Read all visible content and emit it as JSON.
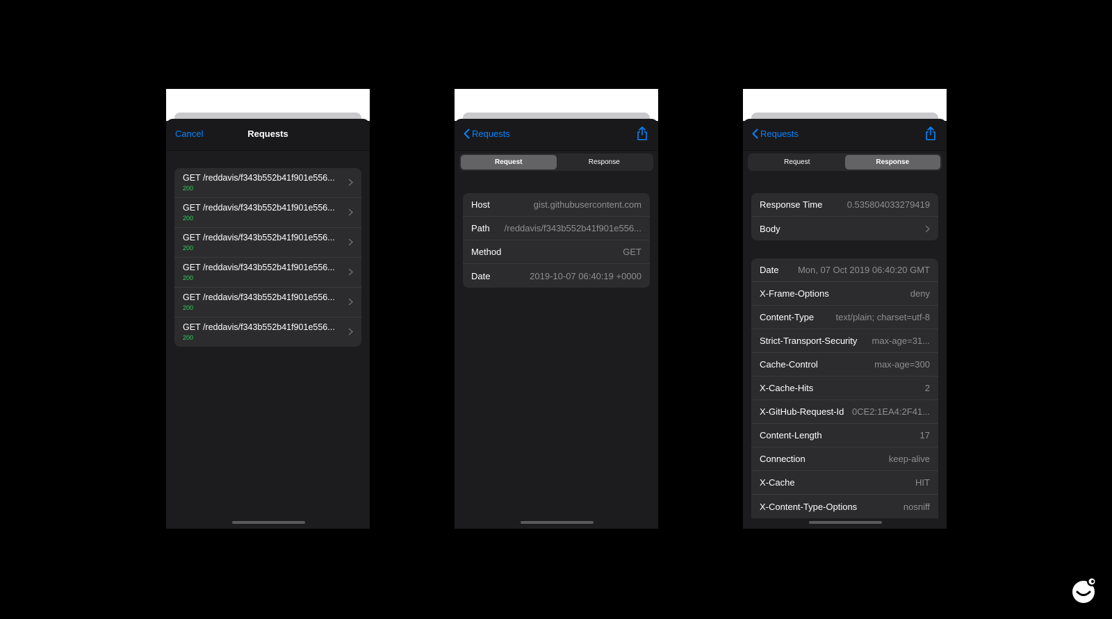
{
  "colors": {
    "accent": "#0a84ff",
    "status_ok": "#30d158"
  },
  "screen1": {
    "nav": {
      "cancel": "Cancel",
      "title": "Requests"
    },
    "requests": [
      {
        "title": "GET /reddavis/f343b552b41f901e556...",
        "status": "200"
      },
      {
        "title": "GET /reddavis/f343b552b41f901e556...",
        "status": "200"
      },
      {
        "title": "GET /reddavis/f343b552b41f901e556...",
        "status": "200"
      },
      {
        "title": "GET /reddavis/f343b552b41f901e556...",
        "status": "200"
      },
      {
        "title": "GET /reddavis/f343b552b41f901e556...",
        "status": "200"
      },
      {
        "title": "GET /reddavis/f343b552b41f901e556...",
        "status": "200"
      }
    ]
  },
  "screen2": {
    "nav": {
      "back": "Requests"
    },
    "tabs": [
      {
        "label": "Request",
        "active": true
      },
      {
        "label": "Response",
        "active": false
      }
    ],
    "fields": [
      {
        "key": "Host",
        "value": "gist.githubusercontent.com"
      },
      {
        "key": "Path",
        "value": "/reddavis/f343b552b41f901e556..."
      },
      {
        "key": "Method",
        "value": "GET"
      },
      {
        "key": "Date",
        "value": "2019-10-07 06:40:19 +0000"
      }
    ]
  },
  "screen3": {
    "nav": {
      "back": "Requests"
    },
    "tabs": [
      {
        "label": "Request",
        "active": false
      },
      {
        "label": "Response",
        "active": true
      }
    ],
    "summary": [
      {
        "key": "Response Time",
        "value": "0.535804033279419"
      },
      {
        "key": "Body",
        "value": ""
      }
    ],
    "headers": [
      {
        "key": "Date",
        "value": "Mon, 07 Oct 2019 06:40:20 GMT"
      },
      {
        "key": "X-Frame-Options",
        "value": "deny"
      },
      {
        "key": "Content-Type",
        "value": "text/plain; charset=utf-8"
      },
      {
        "key": "Strict-Transport-Security",
        "value": "max-age=31..."
      },
      {
        "key": "Cache-Control",
        "value": "max-age=300"
      },
      {
        "key": "X-Cache-Hits",
        "value": "2"
      },
      {
        "key": "X-GitHub-Request-Id",
        "value": "0CE2:1EA4:2F41..."
      },
      {
        "key": "Content-Length",
        "value": "17"
      },
      {
        "key": "Connection",
        "value": "keep-alive"
      },
      {
        "key": "X-Cache",
        "value": "HIT"
      },
      {
        "key": "X-Content-Type-Options",
        "value": "nosniff"
      }
    ]
  }
}
